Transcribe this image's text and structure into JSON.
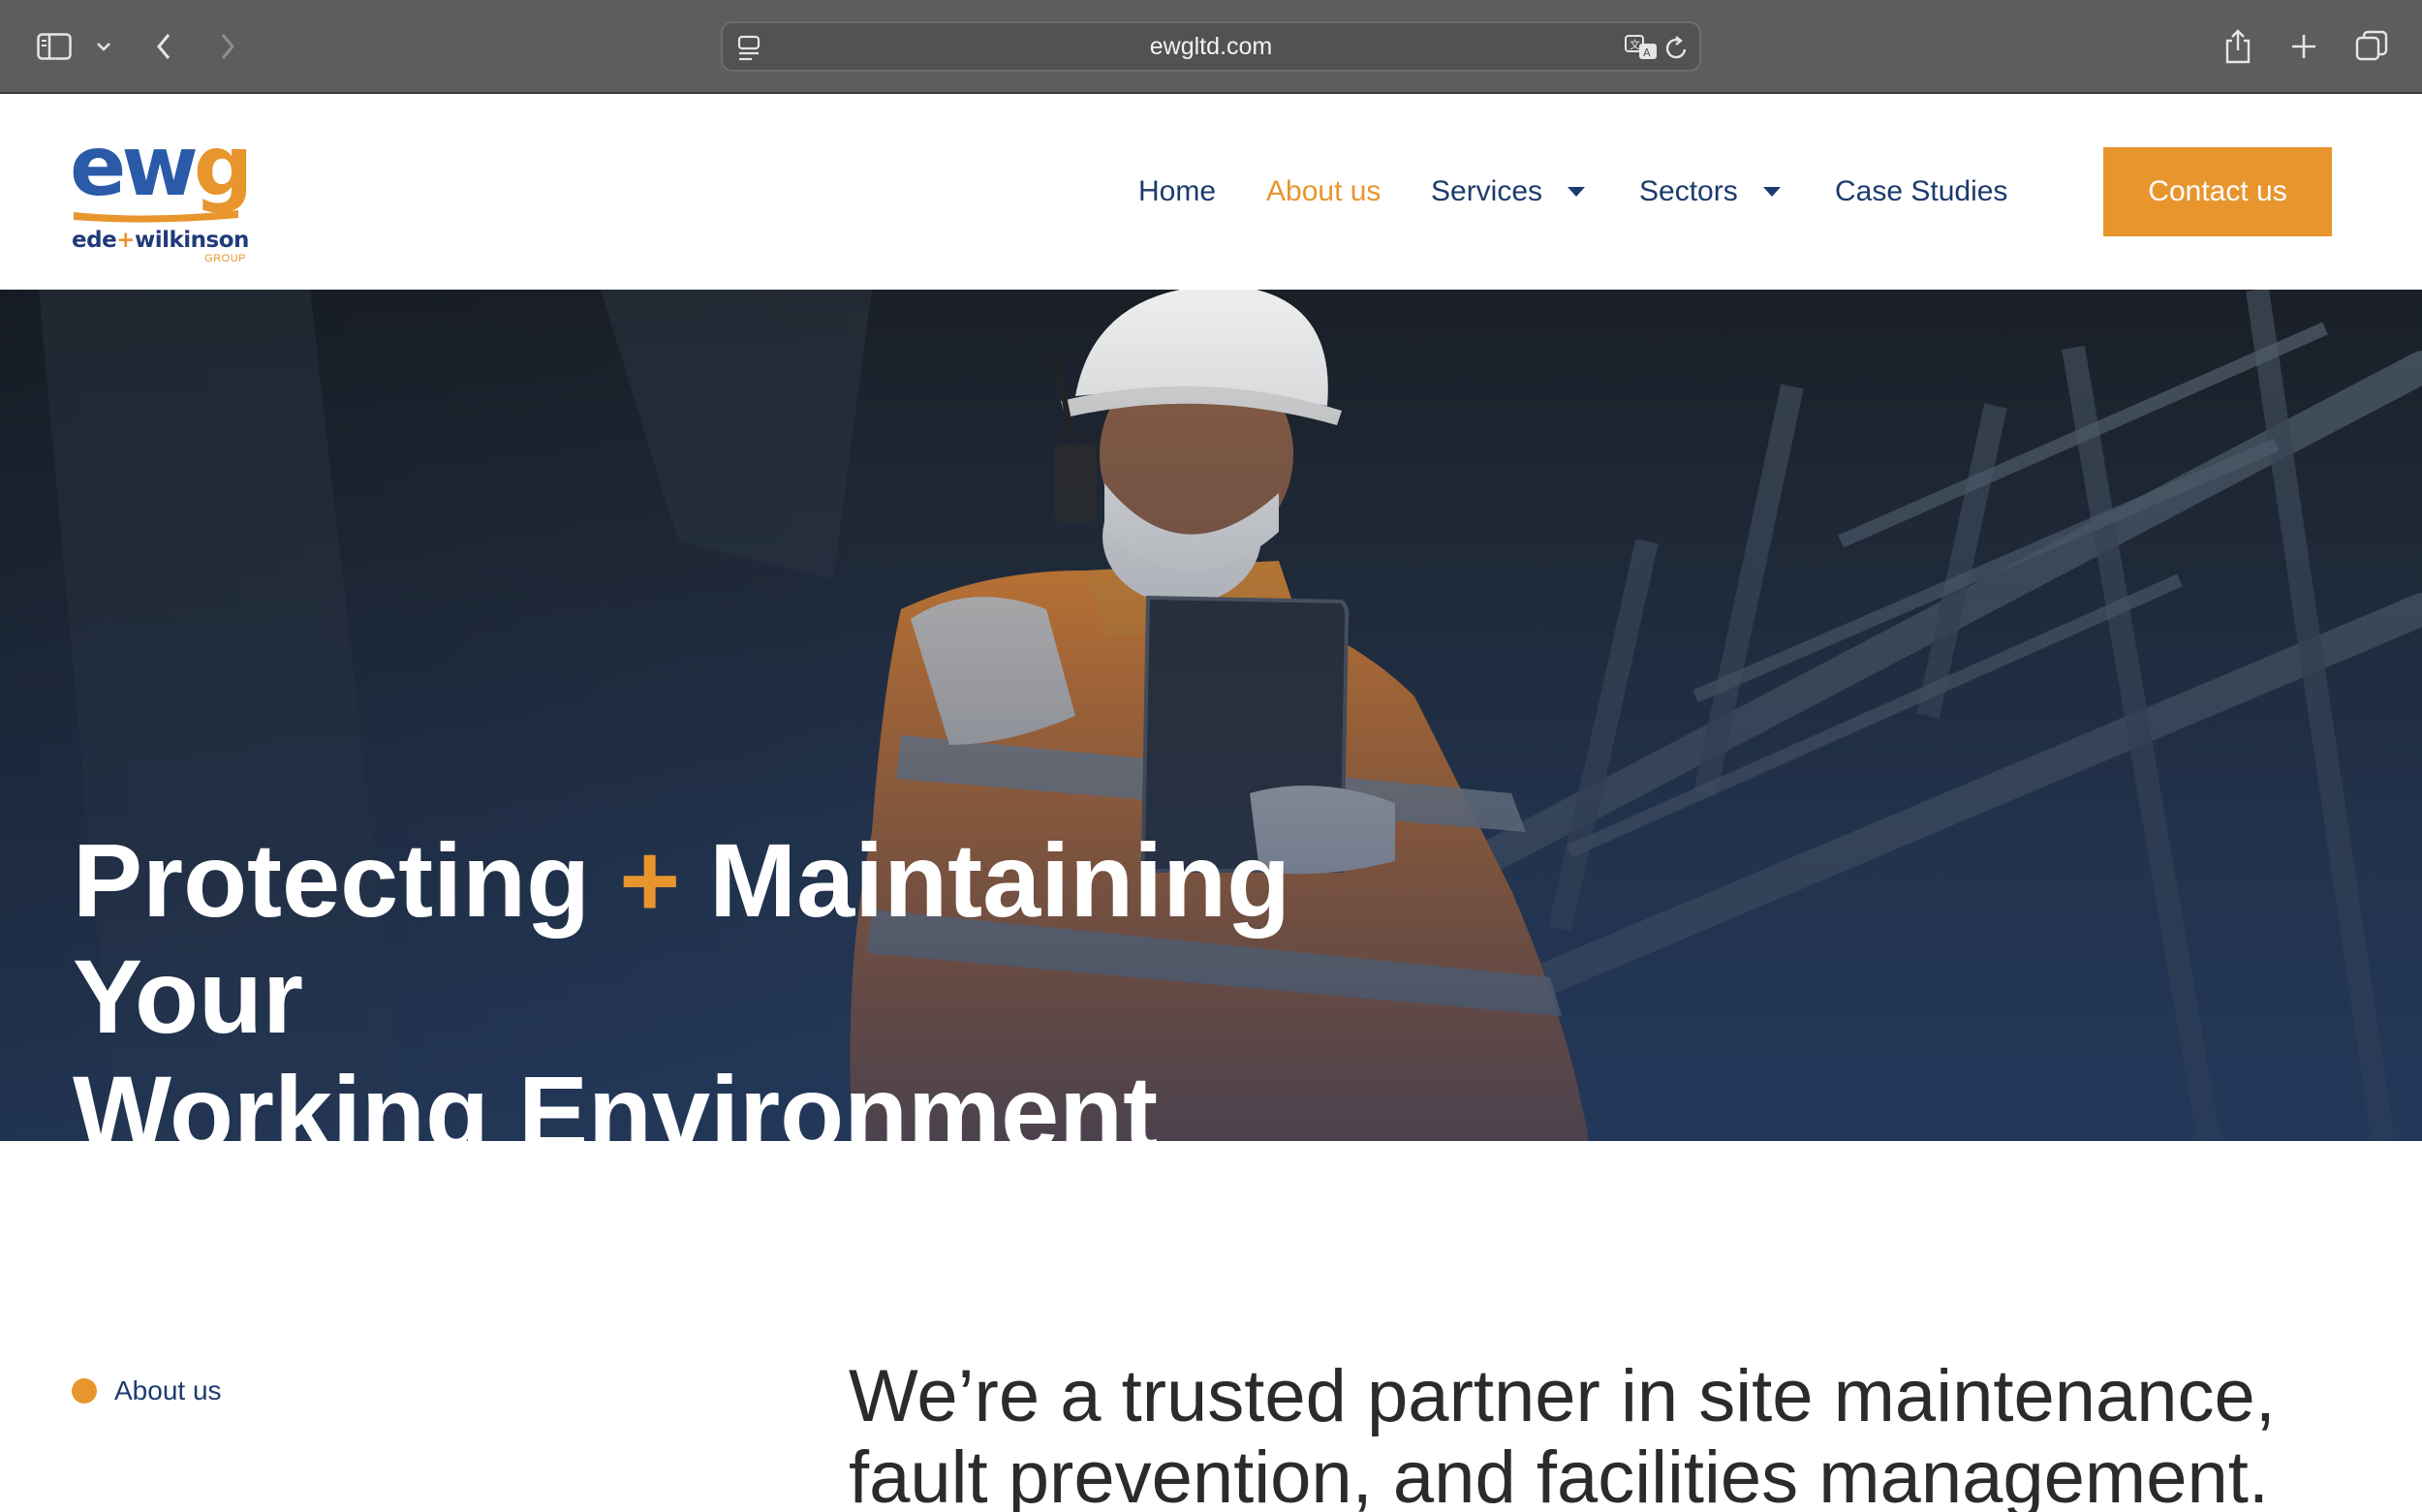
{
  "browser": {
    "url": "ewgltd.com"
  },
  "logo": {
    "mark_e": "e",
    "mark_w": "w",
    "mark_g": "g",
    "name_left": "ede",
    "name_plus": "+",
    "name_right": "wilkinson",
    "sub": "GROUP",
    "colors": {
      "blue": "#2a5aa8",
      "orange": "#e8952e",
      "navy": "#213b7a"
    }
  },
  "nav": {
    "items": [
      {
        "label": "Home",
        "active": false,
        "dropdown": false
      },
      {
        "label": "About us",
        "active": true,
        "dropdown": false
      },
      {
        "label": "Services",
        "active": false,
        "dropdown": true
      },
      {
        "label": "Sectors",
        "active": false,
        "dropdown": true
      },
      {
        "label": "Case Studies",
        "active": false,
        "dropdown": false
      }
    ],
    "cta": "Contact us"
  },
  "hero": {
    "title_part1": "Protecting",
    "title_plus": "+",
    "title_part2": "Maintaining Your",
    "title_line2": "Working Environment"
  },
  "intro": {
    "label": "About us",
    "text": "We’re a trusted partner in site maintenance, fault prevention, and facilities management."
  },
  "theme": {
    "accent": "#e8952e",
    "navy": "#1d3b6e"
  }
}
